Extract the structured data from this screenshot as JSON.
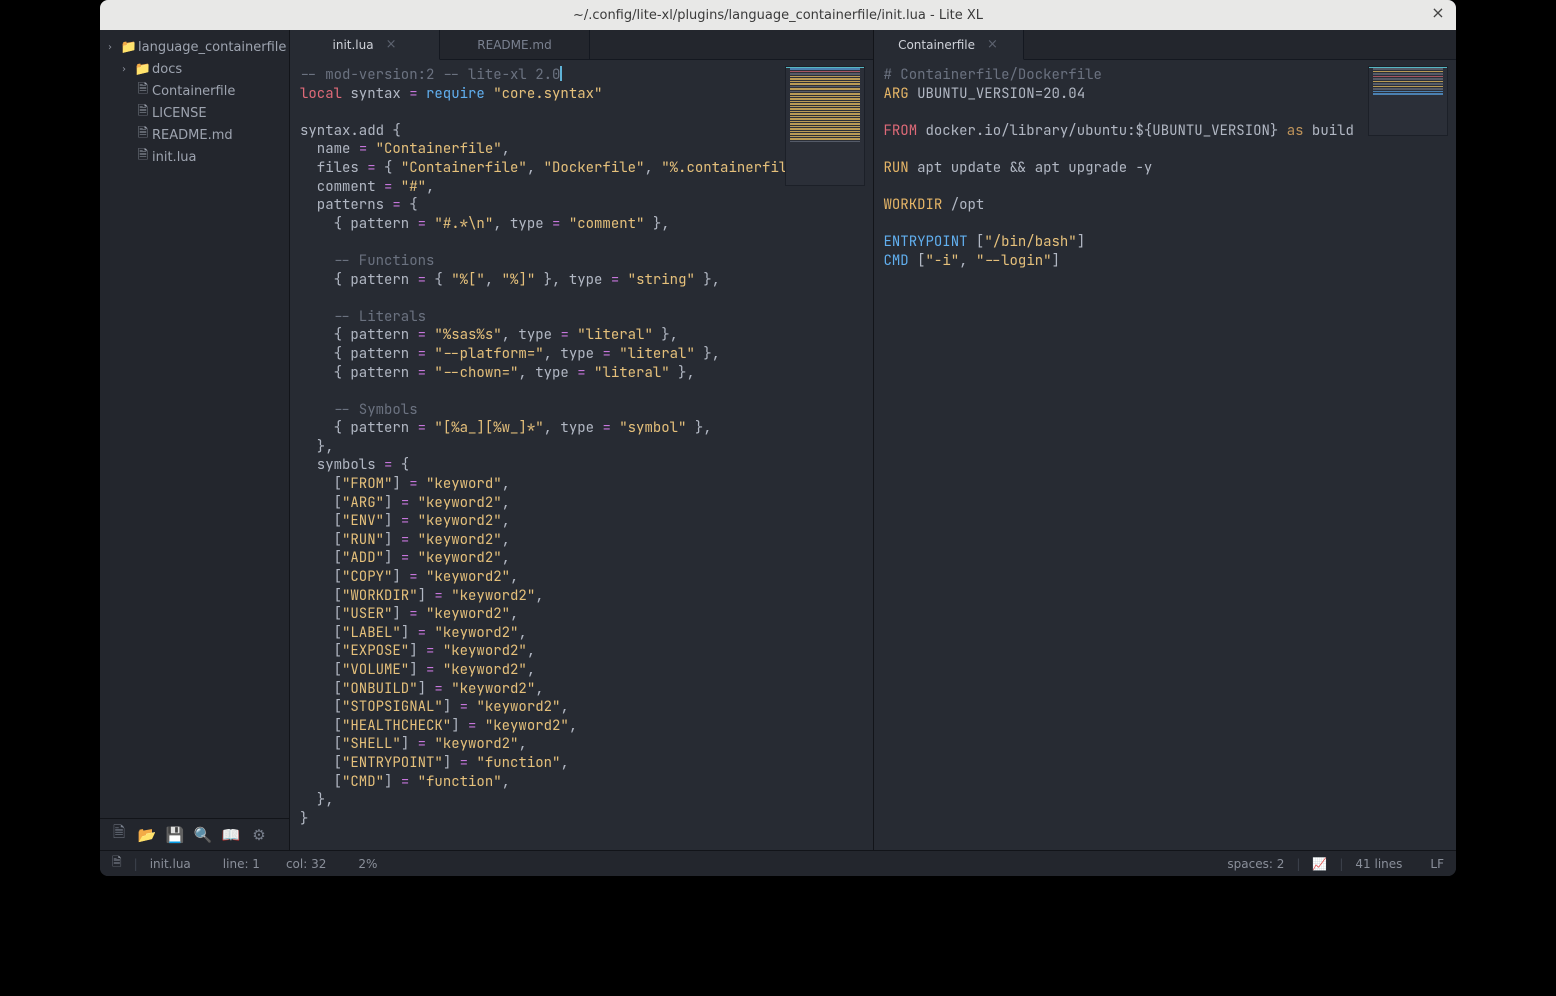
{
  "title": "~/.config/lite-xl/plugins/language_containerfile/init.lua - Lite XL",
  "project_root": "language_containerfile",
  "tree": {
    "folders": [
      {
        "name": "docs"
      }
    ],
    "files": [
      {
        "name": "Containerfile"
      },
      {
        "name": "LICENSE"
      },
      {
        "name": "README.md"
      },
      {
        "name": "init.lua"
      }
    ]
  },
  "tabs_left": [
    {
      "label": "init.lua",
      "active": true,
      "closable": true
    },
    {
      "label": "README.md",
      "active": false,
      "closable": false
    }
  ],
  "tabs_right": [
    {
      "label": "Containerfile",
      "active": true,
      "closable": true
    }
  ],
  "code_left": {
    "l01a": "-- mod-version:2 -- lite-xl 2.0",
    "l02_local": "local",
    "l02_id": " syntax ",
    "l02_eq": "=",
    "l02_req": " require ",
    "l02_str": "\"core.syntax\"",
    "l04": "syntax.add {",
    "l05a": "  name ",
    "l05b": "=",
    "l05c": " \"Containerfile\"",
    "l05d": ",",
    "l06a": "  files ",
    "l06b": "=",
    "l06c": " { ",
    "l06d": "\"Containerfile\"",
    "l06e": ", ",
    "l06f": "\"Dockerfile\"",
    "l06g": ", ",
    "l06h": "\"%.containerfile\"",
    "l06i": " },",
    "l07a": "  comment ",
    "l07b": "=",
    "l07c": " \"#\"",
    "l07d": ",",
    "l08": "  patterns ",
    "l08b": "=",
    "l08c": " {",
    "l09a": "    { pattern ",
    "l09b": "=",
    "l09c": " \"#.*\\n\"",
    "l09d": ", type ",
    "l09e": "=",
    "l09f": " \"comment\"",
    "l09g": " },",
    "l11": "    -- Functions",
    "l12a": "    { pattern ",
    "l12b": "=",
    "l12c": " { ",
    "l12d": "\"%[\"",
    "l12e": ", ",
    "l12f": "\"%]\"",
    "l12g": " }, type ",
    "l12h": "=",
    "l12i": " \"string\"",
    "l12j": " },",
    "l14": "    -- Literals",
    "l15a": "    { pattern ",
    "l15b": "=",
    "l15c": " \"%sas%s\"",
    "l15d": ", type ",
    "l15e": "=",
    "l15f": " \"literal\"",
    "l15g": " },",
    "l16a": "    { pattern ",
    "l16b": "=",
    "l16c": " \"--platform=\"",
    "l16d": ", type ",
    "l16e": "=",
    "l16f": " \"literal\"",
    "l16g": " },",
    "l17a": "    { pattern ",
    "l17b": "=",
    "l17c": " \"--chown=\"",
    "l17d": ", type ",
    "l17e": "=",
    "l17f": " \"literal\"",
    "l17g": " },",
    "l19": "    -- Symbols",
    "l20a": "    { pattern ",
    "l20b": "=",
    "l20c": " \"[%a_][%w_]*\"",
    "l20d": ", type ",
    "l20e": "=",
    "l20f": " \"symbol\"",
    "l20g": " },",
    "l21": "  },",
    "l22": "  symbols ",
    "l22b": "=",
    "l22c": " {",
    "sym": [
      {
        "key": "\"FROM\"",
        "val": "\"keyword\""
      },
      {
        "key": "\"ARG\"",
        "val": "\"keyword2\""
      },
      {
        "key": "\"ENV\"",
        "val": "\"keyword2\""
      },
      {
        "key": "\"RUN\"",
        "val": "\"keyword2\""
      },
      {
        "key": "\"ADD\"",
        "val": "\"keyword2\""
      },
      {
        "key": "\"COPY\"",
        "val": "\"keyword2\""
      },
      {
        "key": "\"WORKDIR\"",
        "val": "\"keyword2\""
      },
      {
        "key": "\"USER\"",
        "val": "\"keyword2\""
      },
      {
        "key": "\"LABEL\"",
        "val": "\"keyword2\""
      },
      {
        "key": "\"EXPOSE\"",
        "val": "\"keyword2\""
      },
      {
        "key": "\"VOLUME\"",
        "val": "\"keyword2\""
      },
      {
        "key": "\"ONBUILD\"",
        "val": "\"keyword2\""
      },
      {
        "key": "\"STOPSIGNAL\"",
        "val": "\"keyword2\""
      },
      {
        "key": "\"HEALTHCHECK\"",
        "val": "\"keyword2\""
      },
      {
        "key": "\"SHELL\"",
        "val": "\"keyword2\""
      },
      {
        "key": "\"ENTRYPOINT\"",
        "val": "\"function\""
      },
      {
        "key": "\"CMD\"",
        "val": "\"function\""
      }
    ],
    "l40": "  },",
    "l41": "}"
  },
  "code_right": {
    "l1": "# Containerfile/Dockerfile",
    "l2a": "ARG",
    "l2b": " UBUNTU_VERSION=20.04",
    "l4a": "FROM",
    "l4b": " docker.io/library/ubuntu:${UBUNTU_VERSION} ",
    "l4c": "as",
    "l4d": " build",
    "l6a": "RUN",
    "l6b": " apt update && apt upgrade -y",
    "l8a": "WORKDIR",
    "l8b": " /opt",
    "l10a": "ENTRYPOINT",
    "l10b": " [",
    "l10c": "\"/bin/bash\"",
    "l10d": "]",
    "l11a": "CMD",
    "l11b": " [",
    "l11c": "\"-i\"",
    "l11d": ", ",
    "l11e": "\"--login\"",
    "l11f": "]"
  },
  "status": {
    "file_icon": "🗎",
    "file": "init.lua",
    "line": "line: 1",
    "col": "col: 32",
    "pct": "2%",
    "spaces": "spaces: 2",
    "lines": "41 lines",
    "eol": "LF"
  }
}
